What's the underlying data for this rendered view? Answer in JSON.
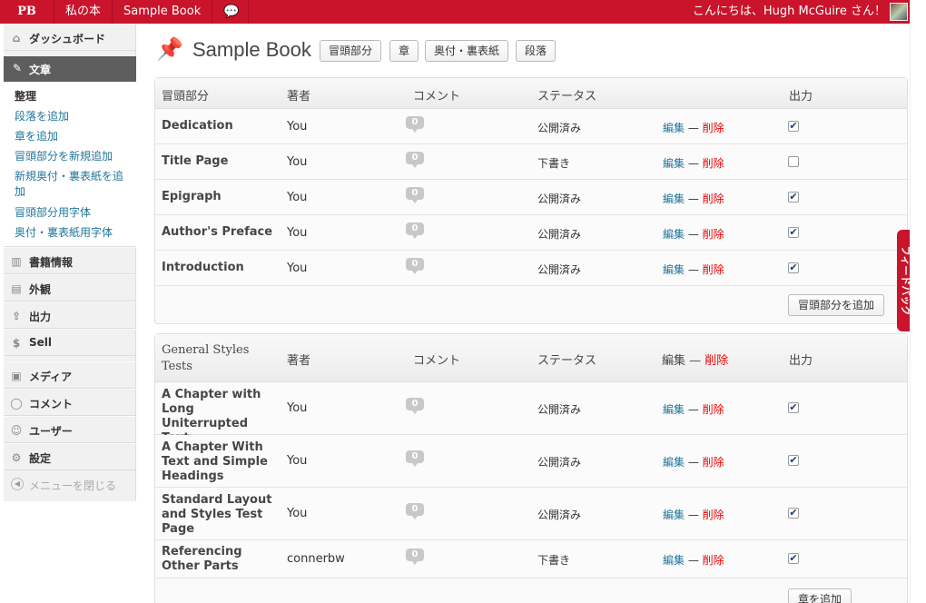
{
  "topbar": {
    "logo": "PB",
    "my_books": "私の本",
    "book_name": "Sample Book",
    "greeting": "こんにちは、Hugh McGuire さん！"
  },
  "sidebar": {
    "dashboard": "ダッシュボード",
    "text": "文章",
    "submenu": [
      "整理",
      "段落を追加",
      "章を追加",
      "冒頭部分を新規追加",
      "新規奥付・裏表紙を追加",
      "冒頭部分用字体",
      "奥付・裏表紙用字体"
    ],
    "book_info": "書籍情報",
    "appearance": "外観",
    "export": "出力",
    "sell": "Sell",
    "media": "メディア",
    "comments": "コメント",
    "users": "ユーザー",
    "settings": "設定",
    "collapse": "メニューを閉じる"
  },
  "main": {
    "title": "Sample Book",
    "buttons": [
      "冒頭部分",
      "章",
      "奥付・裏表紙",
      "段落"
    ]
  },
  "front": {
    "headers": {
      "section": "冒頭部分",
      "author": "著者",
      "comments": "コメント",
      "status": "ステータス",
      "output": "出力"
    },
    "rows": [
      {
        "title": "Dedication",
        "author": "You",
        "comments": "0",
        "status": "公開済み",
        "edit": "編集",
        "sep": " — ",
        "del": "削除",
        "checked": "✔"
      },
      {
        "title": "Title Page",
        "author": "You",
        "comments": "0",
        "status": "下書き",
        "edit": "編集",
        "sep": " — ",
        "del": "削除",
        "checked": ""
      },
      {
        "title": "Epigraph",
        "author": "You",
        "comments": "0",
        "status": "公開済み",
        "edit": "編集",
        "sep": " — ",
        "del": "削除",
        "checked": "✔"
      },
      {
        "title": "Author's Preface",
        "author": "You",
        "comments": "0",
        "status": "公開済み",
        "edit": "編集",
        "sep": " — ",
        "del": "削除",
        "checked": "✔"
      },
      {
        "title": "Introduction",
        "author": "You",
        "comments": "0",
        "status": "公開済み",
        "edit": "編集",
        "sep": " — ",
        "del": "削除",
        "checked": "✔"
      }
    ],
    "add_button": "冒頭部分を追加"
  },
  "part": {
    "headers": {
      "section": "General Styles Tests",
      "author": "著者",
      "comments": "コメント",
      "status": "ステータス",
      "edit": "編集",
      "sep": " — ",
      "del": "削除",
      "output": "出力"
    },
    "rows": [
      {
        "title": "A Chapter with Long Uniterrupted Text",
        "author": "You",
        "comments": "0",
        "status": "公開済み",
        "edit": "編集",
        "sep": " — ",
        "del": "削除",
        "checked": "✔"
      },
      {
        "title": "A Chapter With Text and Simple Headings",
        "author": "You",
        "comments": "0",
        "status": "公開済み",
        "edit": "編集",
        "sep": " — ",
        "del": "削除",
        "checked": "✔"
      },
      {
        "title": "Standard Layout and Styles Test Page",
        "author": "You",
        "comments": "0",
        "status": "公開済み",
        "edit": "編集",
        "sep": " — ",
        "del": "削除",
        "checked": "✔"
      },
      {
        "title": "Referencing Other Parts",
        "author": "connerbw",
        "comments": "0",
        "status": "下書き",
        "edit": "編集",
        "sep": " — ",
        "del": "削除",
        "checked": "✔"
      }
    ],
    "add_button": "章を追加"
  },
  "feedback": "フィードバック"
}
